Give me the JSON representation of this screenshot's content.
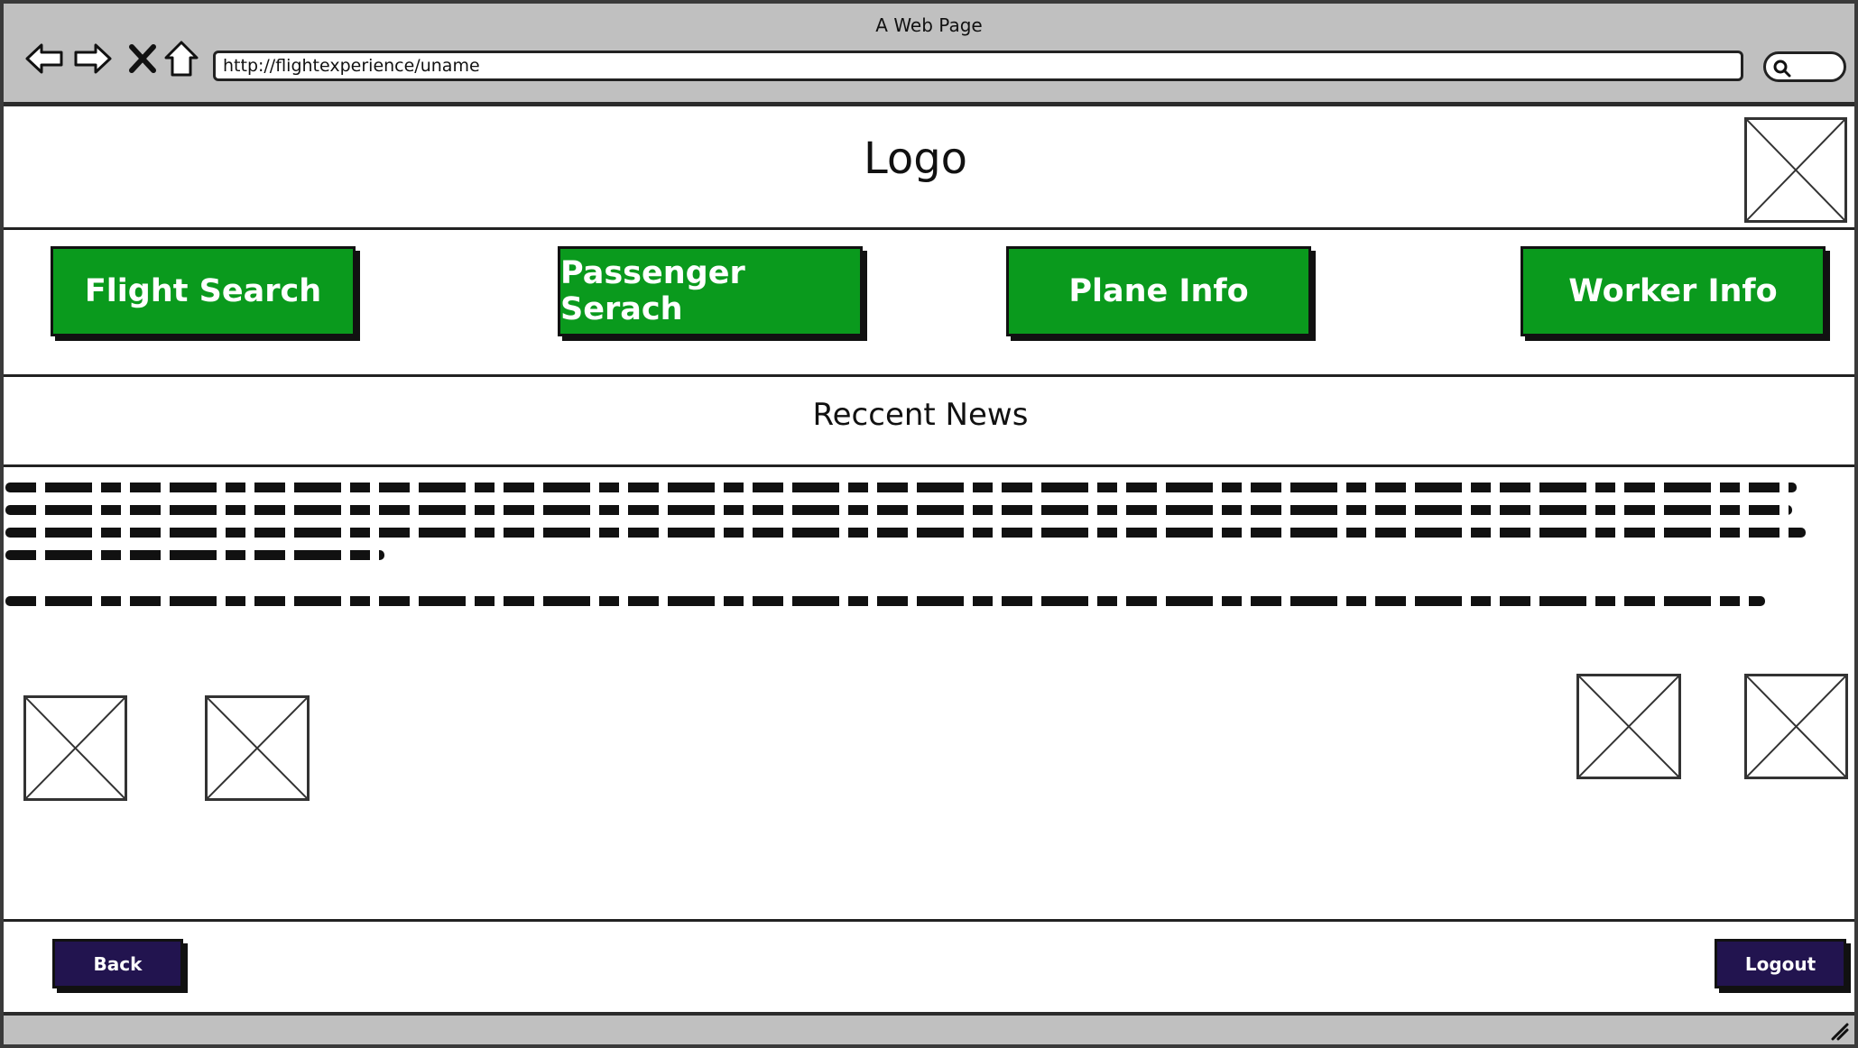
{
  "browser": {
    "window_title": "A Web Page",
    "url": "http://flightexperience/uname",
    "icons": [
      "back-arrow-icon",
      "forward-arrow-icon",
      "close-x-icon",
      "home-icon",
      "search-icon",
      "resize-grip-icon"
    ]
  },
  "header": {
    "logo_text": "Logo"
  },
  "nav": {
    "buttons": [
      {
        "label": "Flight Search"
      },
      {
        "label": "Passenger Serach"
      },
      {
        "label": "Plane Info"
      },
      {
        "label": "Worker Info"
      }
    ],
    "color": "#0a9a1d"
  },
  "news": {
    "title": "Reccent News"
  },
  "footer": {
    "back_label": "Back",
    "logout_label": "Logout",
    "color": "#22144f"
  }
}
